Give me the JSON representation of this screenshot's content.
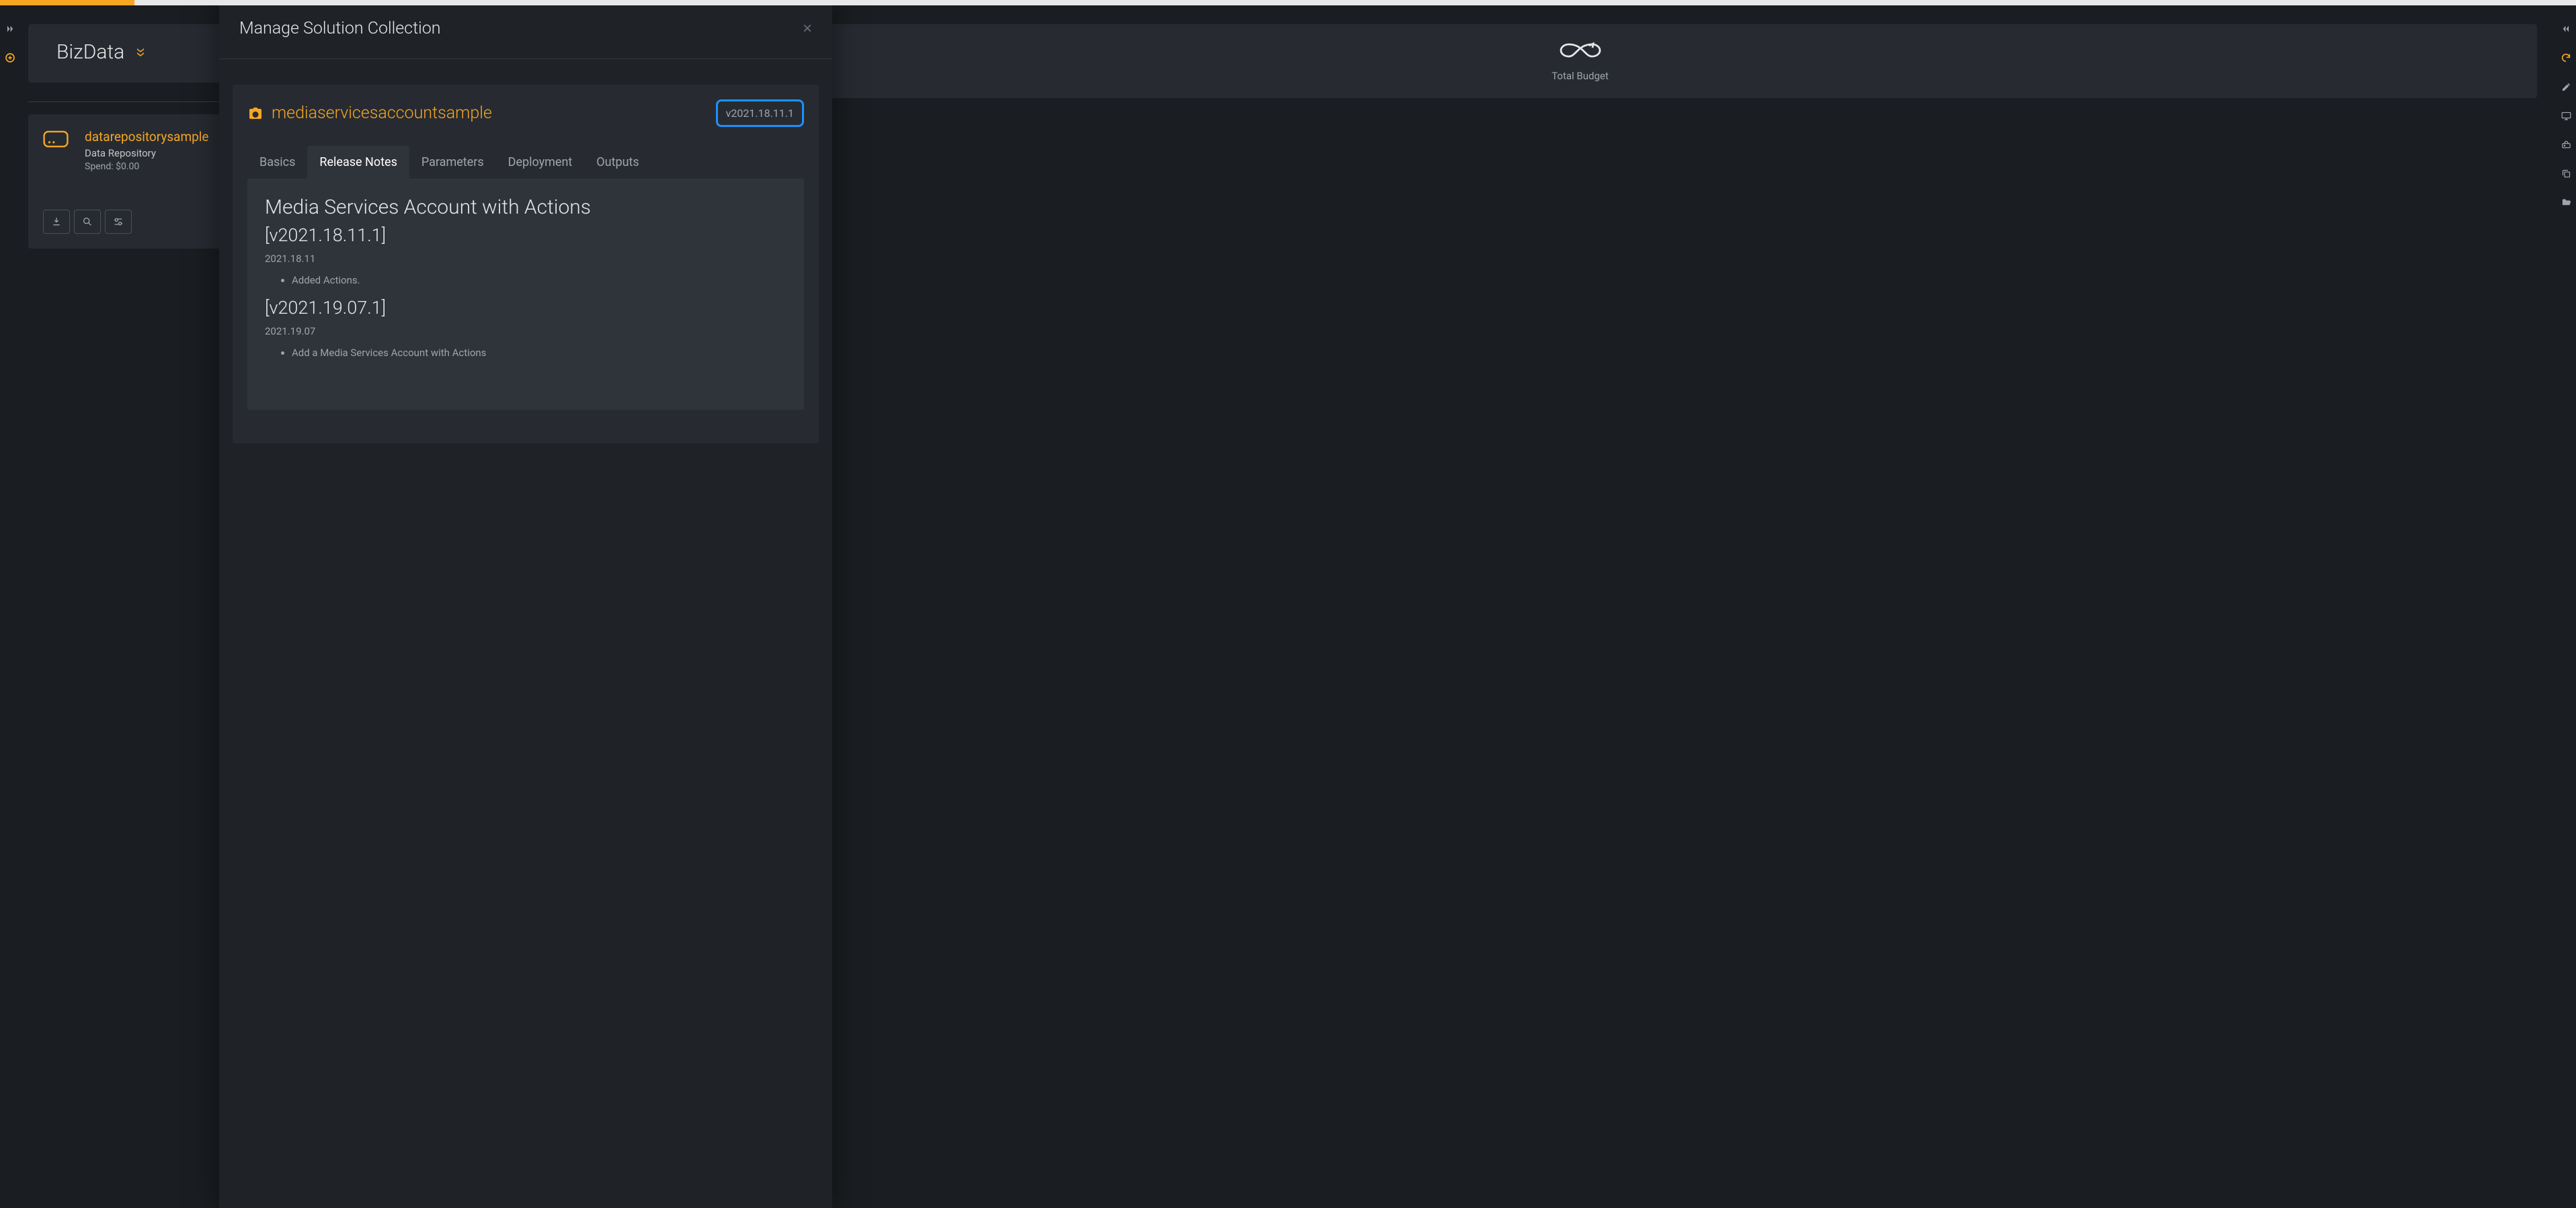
{
  "folder": {
    "name": "BizData"
  },
  "resource": {
    "name": "datarepositorysample",
    "type": "Data Repository",
    "spend": "Spend: $0.00"
  },
  "budget": {
    "label": "Total Budget"
  },
  "modal": {
    "title": "Manage Solution Collection",
    "solution": {
      "name": "mediaservicesaccountsample",
      "version": "v2021.18.11.1"
    },
    "tabs": {
      "basics": "Basics",
      "release": "Release Notes",
      "params": "Parameters",
      "deploy": "Deployment",
      "outputs": "Outputs"
    },
    "notes": {
      "title": "Media Services Account with Actions",
      "entries": [
        {
          "version": "[v2021.18.11.1]",
          "date": "2021.18.11",
          "items": [
            "Added Actions."
          ]
        },
        {
          "version": "[v2021.19.07.1]",
          "date": "2021.19.07",
          "items": [
            "Add a Media Services Account with Actions"
          ]
        }
      ]
    }
  }
}
